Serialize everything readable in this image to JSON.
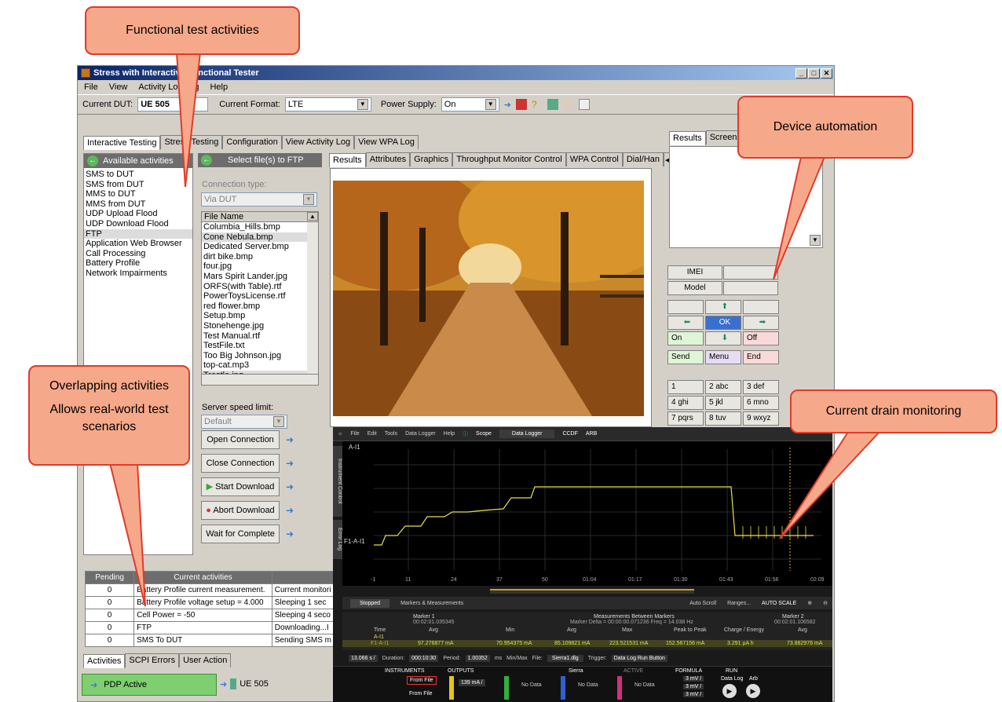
{
  "window": {
    "title": "Stress with Interactive Functional Tester"
  },
  "menu": [
    "File",
    "View",
    "Activity Logging",
    "Help"
  ],
  "toolbar": {
    "dut_label": "Current DUT:",
    "dut_value": "UE 505",
    "format_label": "Current Format:",
    "format_value": "LTE",
    "power_label": "Power Supply:",
    "power_value": "On"
  },
  "main_tabs": [
    "Interactive Testing",
    "Stress Testing",
    "Configuration",
    "View Activity Log",
    "View WPA Log"
  ],
  "activities": {
    "header": "Available activities",
    "items": [
      "SMS to DUT",
      "SMS from DUT",
      "MMS to DUT",
      "MMS from DUT",
      "UDP Upload Flood",
      "UDP Download Flood",
      "FTP",
      "Application Web Browser",
      "Call Processing",
      "Battery Profile",
      "Network Impairments"
    ]
  },
  "ftp": {
    "header": "Select file(s) to FTP",
    "connection_label": "Connection type:",
    "connection_value": "Via DUT",
    "file_header": "File Name",
    "files": [
      "Columbia_Hills.bmp",
      "Cone Nebula.bmp",
      "Dedicated Server.bmp",
      "dirt bike.bmp",
      "four.jpg",
      "Mars Spirit Lander.jpg",
      "ORFS(with Table).rtf",
      "PowerToysLicense.rtf",
      "red flower.bmp",
      "Setup.bmp",
      "Stonehenge.jpg",
      "Test Manual.rtf",
      "TestFile.txt",
      "Too Big Johnson.jpg",
      "top-cat.mp3",
      "Trestle.jpg"
    ],
    "speed_label": "Server speed limit:",
    "speed_value": "Default",
    "buttons": [
      "Open Connection",
      "Close Connection",
      "Start Download",
      "Abort Download",
      "Wait for Complete"
    ]
  },
  "result_tabs": [
    "Results",
    "Attributes",
    "Graphics",
    "Throughput Monitor Control",
    "WPA Control",
    "Dial/Han"
  ],
  "device_tabs": [
    "Results",
    "Screen Im"
  ],
  "device": {
    "imei_label": "IMEI",
    "model_label": "Model",
    "ok": "OK",
    "on": "On",
    "off": "Off",
    "send": "Send",
    "menu": "Menu",
    "end": "End",
    "keys": [
      "1",
      "2 abc",
      "3 def",
      "4 ghi",
      "5 jkl",
      "6 mno",
      "7 pqrs",
      "8 tuv",
      "9 wxyz"
    ]
  },
  "current_activities": {
    "headers": [
      "Pending",
      "Current activities",
      ""
    ],
    "rows": [
      [
        "0",
        "Battery Profile current measurement.",
        "Current monitori"
      ],
      [
        "0",
        "Battery Profile voltage setup = 4.000",
        "Sleeping 1 sec"
      ],
      [
        "0",
        "Cell Power = -50",
        "Sleeping 4 seco"
      ],
      [
        "0",
        "FTP",
        "Downloading...I"
      ],
      [
        "0",
        "SMS To DUT",
        "Sending SMS m"
      ]
    ]
  },
  "bottom_tabs": [
    "Activities",
    "SCPI Errors",
    "User Action"
  ],
  "status": {
    "pdp": "PDP Active",
    "dut": "UE 505"
  },
  "datalogger": {
    "menu": [
      "File",
      "Edit",
      "Tools",
      "Data Logger",
      "Help",
      "Scope",
      "Data Logger",
      "CCDF",
      "ARB"
    ],
    "side_tabs": [
      "Instrument Control",
      "Error Log"
    ],
    "trace_top": "A-I1",
    "trace_left": "F1-A-I1",
    "x_ticks": [
      "-1",
      "11",
      "24",
      "37",
      "50",
      "01:04",
      "01:17",
      "01:30",
      "01:43",
      "01:56",
      "02:09"
    ],
    "stopped": "Stopped",
    "markers_title": "Markers & Measurements",
    "auto_scroll": "Auto Scroll",
    "ranges": "Ranges...",
    "auto_scale": "AUTO SCALE",
    "marker1": "Marker 1",
    "marker1_time": "00:02:01.035345",
    "between": "Measurements Between Markers",
    "between_sub": "Marker Delta = 00:00:00.071236   Freq = 14.038 Hz",
    "marker2": "Marker 2",
    "marker2_time": "00:02:01.106582",
    "col_headers": [
      "Time",
      "Avg",
      "Min",
      "Avg",
      "Max",
      "Peak to Peak",
      "Charge / Energy",
      "Avg"
    ],
    "row_labels": [
      "A-I1",
      "F1-A-I1"
    ],
    "values": [
      "97.276877 mA",
      "70.954375 mA",
      "85.109821 mA",
      "223.521531 mA",
      "152.567156 mA",
      "3.291 µA h",
      "73.882976 mA"
    ],
    "controls": {
      "scale": "13.066 s /",
      "duration_label": "Duration:",
      "duration": "000:10:30",
      "period_label": "Period:",
      "period": "1.00352",
      "period_unit": "ms",
      "minmax": "Min/Max",
      "file_label": "File:",
      "file": "Sierra1.dlg",
      "trigger_label": "Trigger:",
      "trigger": "Data Log Run Button"
    },
    "footer": {
      "instruments": "INSTRUMENTS",
      "outputs": "OUTPUTS",
      "sierra": "Sierra",
      "active": "ACTIVE",
      "formula": "FORMULA",
      "run": "RUN",
      "from_file": "From File",
      "ch1": "139 mA /",
      "no_data": "No Data",
      "f_val": "3 mV /",
      "data_log": "Data Log",
      "arb": "Arb"
    }
  },
  "callouts": {
    "functional": "Functional test activities",
    "device": "Device automation",
    "overlap1": "Overlapping activities",
    "overlap2": "Allows real-world test scenarios",
    "drain": "Current drain monitoring"
  },
  "colors": {
    "callout_fill": "#f6a98a",
    "callout_border": "#e23a2a",
    "trace": "#e8e04a",
    "ok_blue": "#3a6fd0",
    "pdp_green": "#7dcf6f"
  }
}
